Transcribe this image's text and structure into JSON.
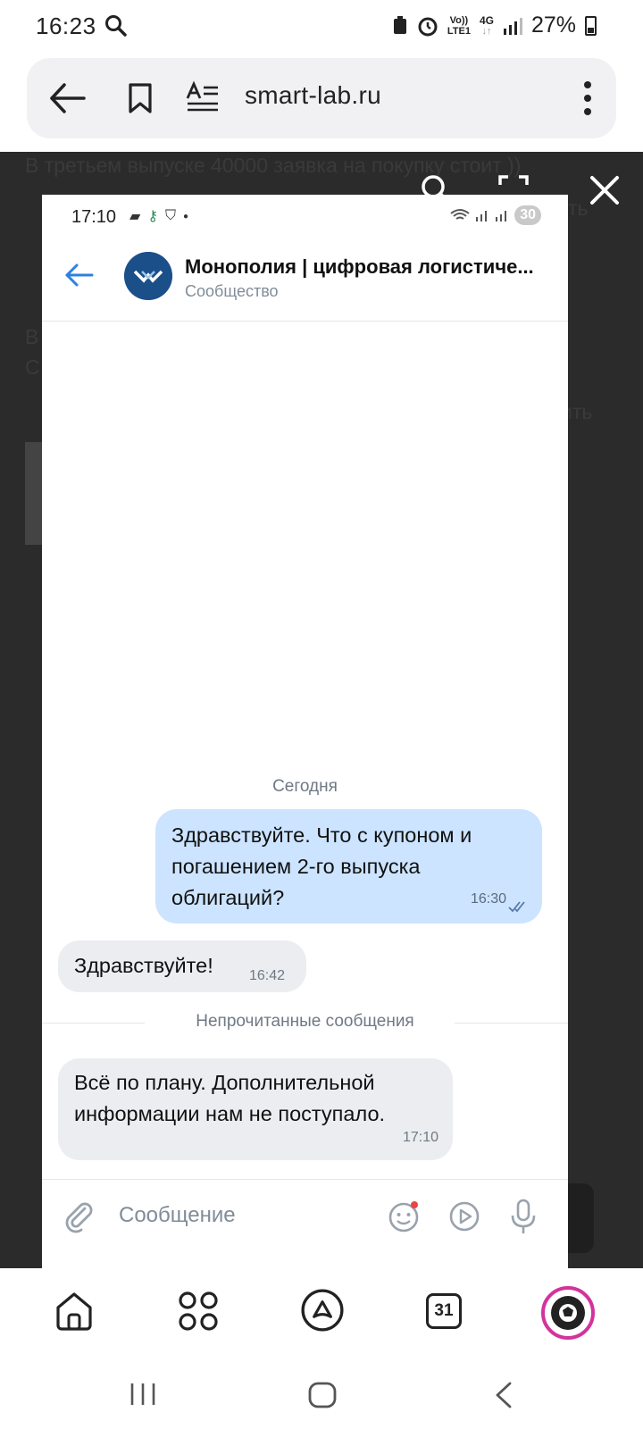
{
  "phone_status": {
    "time": "16:23",
    "battery": "27%",
    "net_top": "Vo))",
    "net_bottom": "LTE1",
    "net4g": "4G"
  },
  "browser": {
    "url": "smart-lab.ru"
  },
  "webpage_bg": {
    "line1": "В третьем выпуске 40000 заявка на покупку стоит ))",
    "frag1": "ть",
    "frag2": "В",
    "frag3": "С",
    "frag4": "ить"
  },
  "shot_status": {
    "time": "17:10",
    "badge": "30"
  },
  "chat": {
    "title": "Монополия | цифровая логистиче...",
    "subtitle": "Сообщество",
    "date_separator": "Сегодня",
    "unread_label": "Непрочитанные сообщения",
    "messages": [
      {
        "direction": "out",
        "text": "Здравствуйте. Что с купоном и погашением 2-го выпуска облигаций?",
        "time": "16:30"
      },
      {
        "direction": "in",
        "text": "Здравствуйте!",
        "time": "16:42"
      },
      {
        "direction": "in",
        "text": "Всё по плану. Дополнительной информации нам не поступало.",
        "time": "17:10"
      }
    ],
    "composer_placeholder": "Сообщение"
  },
  "bottom_nav": {
    "calendar_day": "31"
  },
  "colors": {
    "outgoing_bubble": "#cce4ff",
    "incoming_bubble": "#ebedf0",
    "accent": "#2d81e0",
    "avatar": "#1b4f8a"
  }
}
